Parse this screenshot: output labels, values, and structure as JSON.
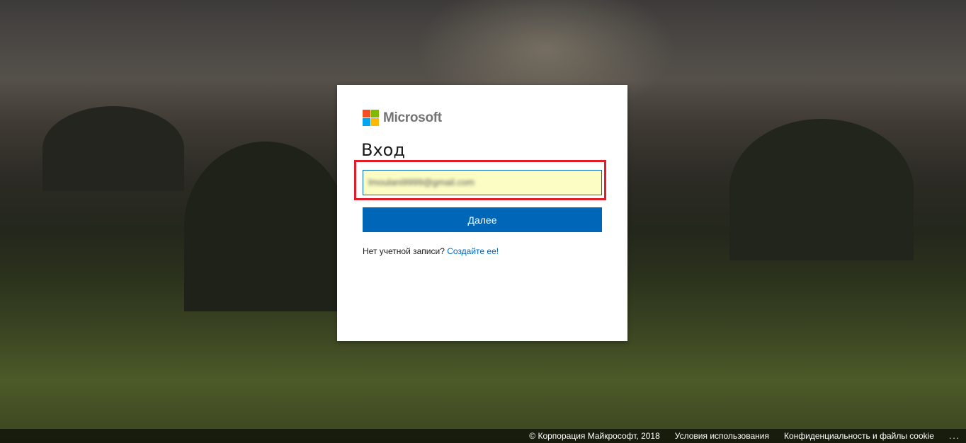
{
  "logo": {
    "text": "Microsoft",
    "colors": [
      "#f25022",
      "#7fba00",
      "#00a4ef",
      "#ffb900"
    ]
  },
  "signin": {
    "title": "Вход",
    "email_value": "lmoulani9999@gmail.com",
    "next_label": "Далее",
    "no_account_text": "Нет учетной записи?",
    "create_link": "Создайте ее!"
  },
  "footer": {
    "copyright": "© Корпорация Майкрософт, 2018",
    "terms": "Условия использования",
    "privacy": "Конфиденциальность и файлы cookie",
    "more": "..."
  },
  "colors": {
    "accent": "#0067b8",
    "highlight": "#e11d2b",
    "input_bg": "#fbfdc4"
  }
}
